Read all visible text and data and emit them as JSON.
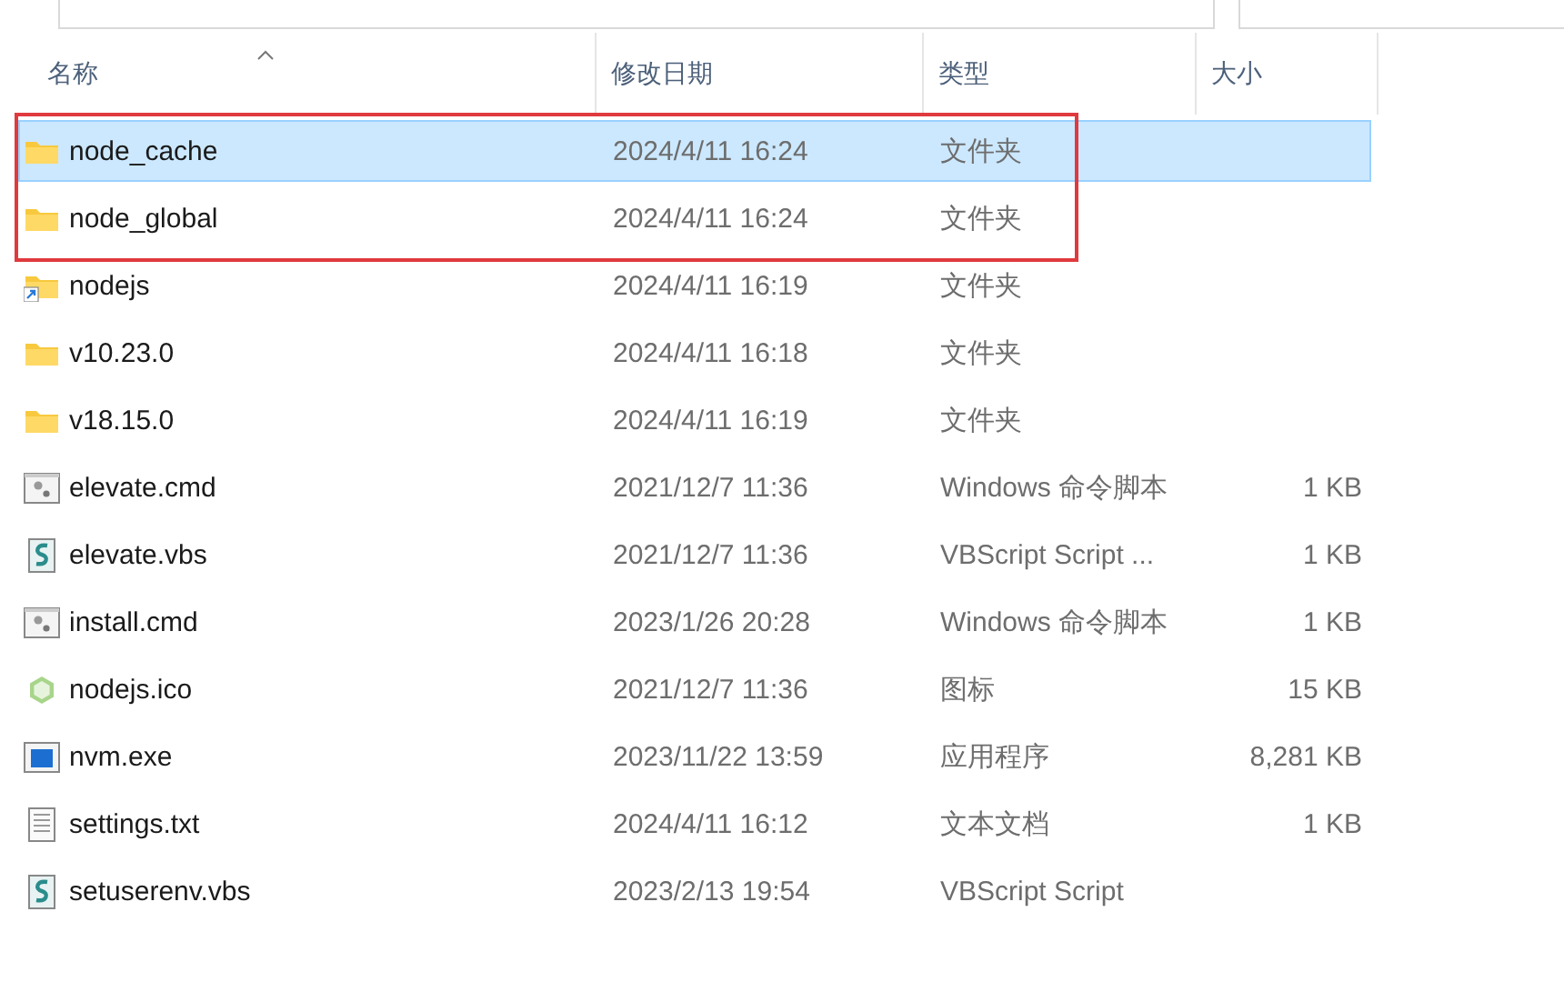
{
  "columns": [
    {
      "label": "名称",
      "sorted": true
    },
    {
      "label": "修改日期",
      "sorted": false
    },
    {
      "label": "类型",
      "sorted": false
    },
    {
      "label": "大小",
      "sorted": false
    }
  ],
  "rows": [
    {
      "name": "node_cache",
      "kind": "folder",
      "date": "2024/4/11 16:24",
      "type": "文件夹",
      "selected": true,
      "highlighted": true
    },
    {
      "name": "node_global",
      "kind": "folder",
      "date": "2024/4/11 16:24",
      "type": "文件夹",
      "selected": false,
      "highlighted": true
    },
    {
      "name": "nodejs",
      "kind": "shortcut",
      "date": "2024/4/11 16:19",
      "type": "文件夹",
      "selected": false,
      "highlighted": false
    },
    {
      "name": "v10.23.0",
      "kind": "folder",
      "date": "2024/4/11 16:18",
      "type": "文件夹",
      "selected": false,
      "highlighted": false
    },
    {
      "name": "v18.15.0",
      "kind": "folder",
      "date": "2024/4/11 16:19",
      "type": "文件夹",
      "selected": false,
      "highlighted": false
    },
    {
      "name": "elevate.cmd",
      "kind": "batch",
      "date": "2021/12/7 11:36",
      "type": "Windows 命令脚本",
      "size": "1 KB",
      "selected": false,
      "highlighted": false
    },
    {
      "name": "elevate.vbs",
      "kind": "script",
      "date": "2021/12/7 11:36",
      "type": "VBScript Script ...",
      "size": "1 KB",
      "selected": false,
      "highlighted": false
    },
    {
      "name": "install.cmd",
      "kind": "batch",
      "date": "2023/1/26 20:28",
      "type": "Windows 命令脚本",
      "size": "1 KB",
      "selected": false,
      "highlighted": false
    },
    {
      "name": "nodejs.ico",
      "kind": "image",
      "date": "2021/12/7 11:36",
      "type": "图标",
      "size": "15 KB",
      "selected": false,
      "highlighted": false
    },
    {
      "name": "nvm.exe",
      "kind": "program",
      "date": "2023/11/22 13:59",
      "type": "应用程序",
      "size": "8,281 KB",
      "selected": false,
      "highlighted": false
    },
    {
      "name": "settings.txt",
      "kind": "text",
      "date": "2024/4/11 16:12",
      "type": "文本文档",
      "size": "1 KB",
      "selected": false,
      "highlighted": false
    },
    {
      "name": "setuserenv.vbs",
      "kind": "script",
      "date": "2023/2/13 19:54",
      "type": "VBScript Script",
      "selected": false,
      "highlighted": false
    }
  ]
}
